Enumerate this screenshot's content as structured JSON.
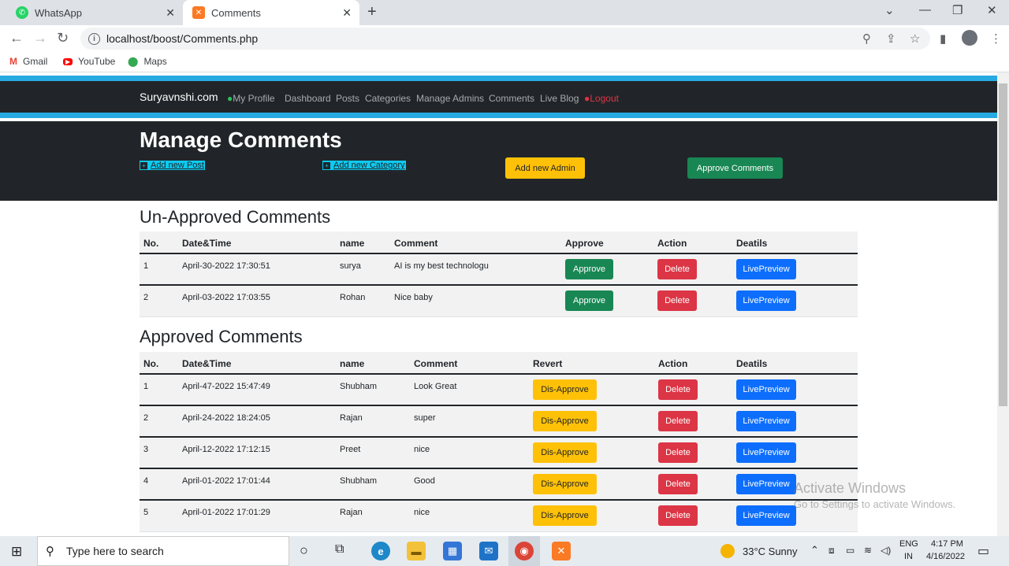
{
  "browser": {
    "tabs": [
      {
        "title": "WhatsApp",
        "favicon": "whatsapp-icon",
        "active": false
      },
      {
        "title": "Comments",
        "favicon": "xampp-icon",
        "active": true
      }
    ],
    "new_tab": "+",
    "url": "localhost/boost/Comments.php",
    "bookmarks": [
      {
        "label": "Gmail",
        "icon": "gmail-icon"
      },
      {
        "label": "YouTube",
        "icon": "youtube-icon"
      },
      {
        "label": "Maps",
        "icon": "maps-icon"
      }
    ]
  },
  "site": {
    "brand": "Suryavnshi.com",
    "nav": [
      "My Profile",
      "Dashboard",
      "Posts",
      "Categories",
      "Manage Admins",
      "Comments",
      "Live Blog"
    ],
    "logout": "Logout",
    "colors": {
      "stripe": "#27aae1",
      "dark": "#212529",
      "info": "#0dcaf0"
    }
  },
  "hero": {
    "title": "Manage Comments",
    "add_post": "Add new Post",
    "add_category": "Add new Category",
    "add_admin": "Add new Admin",
    "approve_comments": "Approve Comments"
  },
  "unapproved": {
    "title": "Un-Approved Comments",
    "headers": [
      "No.",
      "Date&Time",
      "name",
      "Comment",
      "Approve",
      "Action",
      "Deatils"
    ],
    "approve_label": "Approve",
    "delete_label": "Delete",
    "preview_label": "LivePreview",
    "rows": [
      {
        "no": "1",
        "datetime": "April-30-2022 17:30:51",
        "name": "surya",
        "comment": "AI is my best technologu"
      },
      {
        "no": "2",
        "datetime": "April-03-2022 17:03:55",
        "name": "Rohan",
        "comment": "Nice baby"
      }
    ]
  },
  "approved": {
    "title": "Approved Comments",
    "headers": [
      "No.",
      "Date&Time",
      "name",
      "Comment",
      "Revert",
      "Action",
      "Deatils"
    ],
    "revert_label": "Dis-Approve",
    "delete_label": "Delete",
    "preview_label": "LivePreview",
    "rows": [
      {
        "no": "1",
        "datetime": "April-47-2022 15:47:49",
        "name": "Shubham",
        "comment": "Look Great"
      },
      {
        "no": "2",
        "datetime": "April-24-2022 18:24:05",
        "name": "Rajan",
        "comment": "super"
      },
      {
        "no": "3",
        "datetime": "April-12-2022 17:12:15",
        "name": "Preet",
        "comment": "nice"
      },
      {
        "no": "4",
        "datetime": "April-01-2022 17:01:44",
        "name": "Shubham",
        "comment": "Good"
      },
      {
        "no": "5",
        "datetime": "April-01-2022 17:01:29",
        "name": "Rajan",
        "comment": "nice"
      }
    ]
  },
  "watermark": {
    "line1": "Activate Windows",
    "line2": "Go to Settings to activate Windows."
  },
  "taskbar": {
    "search_placeholder": "Type here to search",
    "weather": "33°C  Sunny",
    "lang1": "ENG",
    "lang2": "IN",
    "time": "4:17 PM",
    "date": "4/16/2022"
  }
}
